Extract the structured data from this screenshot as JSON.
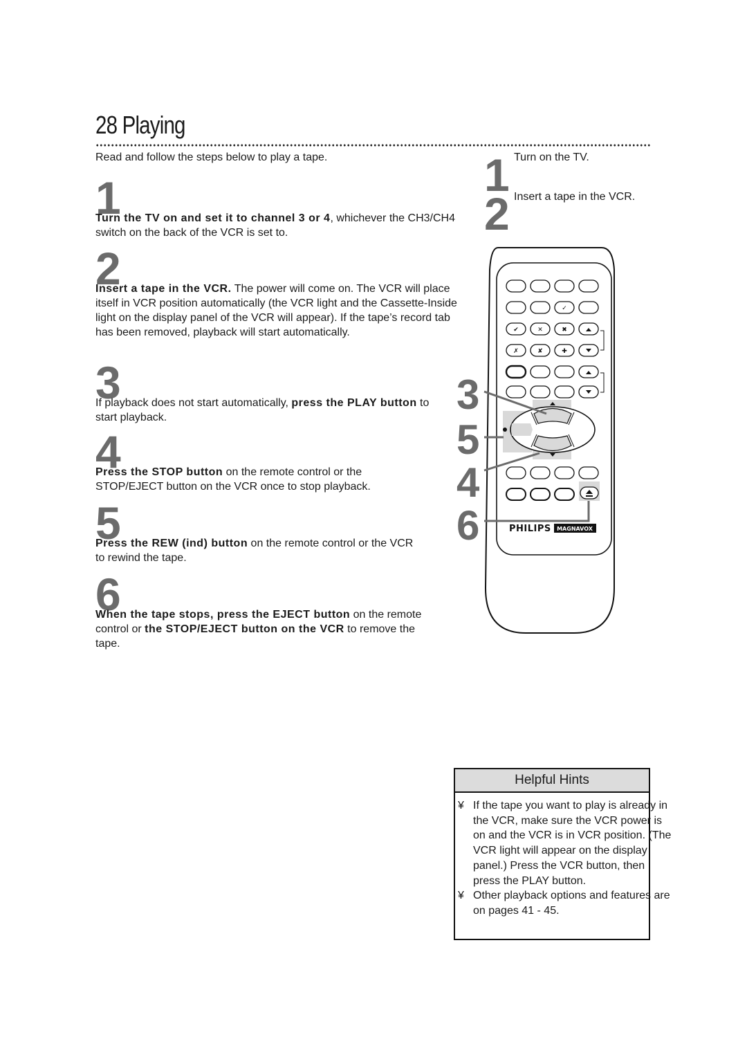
{
  "page": {
    "number": "28",
    "title": "Playing",
    "title_full": "28  Playing"
  },
  "intro": "Read and follow the steps below to play a tape.",
  "steps": [
    {
      "number": "1",
      "bold": "Turn the TV on and set it to channel 3 or 4",
      "text": ", whichever the CH3/CH4 switch on the back of the VCR is set to."
    },
    {
      "number": "2",
      "bold": "Insert a tape in the VCR.",
      "text": " The power will come on. The VCR will place itself in VCR position automatically (the VCR light and the Cassette-Inside light on the display panel of the VCR will appear). If the tape’s record tab has been removed, playback will start automatically."
    },
    {
      "number": "3",
      "text_before": "If playback does not start automatically, ",
      "bold": "press the PLAY button",
      "text": " to start playback."
    },
    {
      "number": "4",
      "bold": "Press the STOP button",
      "text": " on the remote control or the STOP/EJECT button on the VCR once to stop playback."
    },
    {
      "number": "5",
      "bold": "Press the REW (ind) button",
      "text": " on the remote control or the VCR to rewind the tape."
    },
    {
      "number": "6",
      "bold": "When the tape stops, press the EJECT button",
      "text": " on the remote control or ",
      "bold2": "the STOP/EJECT button on the VCR",
      "text2": " to remove the tape."
    }
  ],
  "sidebar_steps": [
    {
      "number": "1",
      "text": "Turn on the TV."
    },
    {
      "number": "2",
      "text": "Insert a tape in the VCR."
    }
  ],
  "remote": {
    "callouts": [
      "3",
      "5",
      "4",
      "6"
    ],
    "brand_primary": "PHILIPS",
    "brand_secondary": "MAGNAVOX",
    "callout_color": "#6b6b6b",
    "highlight_color": "#d9d9d9"
  },
  "hints": {
    "title": "Helpful Hints",
    "bullet": "¥",
    "items": [
      "If the tape you want to play is already in the VCR, make sure the VCR power is on and the VCR is in VCR position. (The VCR light will appear on the display panel.) Press the VCR button, then press the PLAY button.",
      "Other playback options and features are on pages 41 - 45."
    ]
  }
}
